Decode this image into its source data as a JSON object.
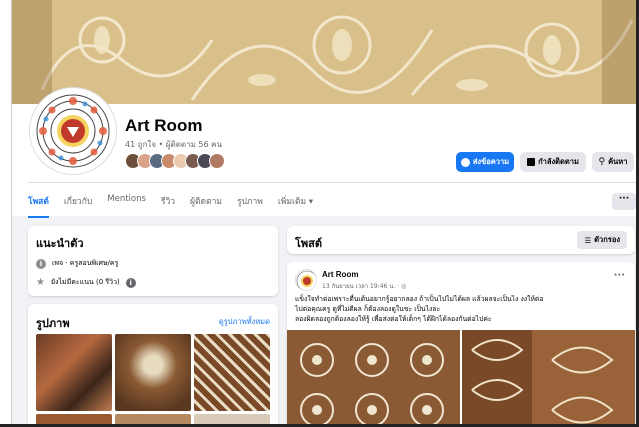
{
  "page": {
    "name": "Art Room",
    "stats": "41 ถูกใจ • ผู้ติดตาม 56 คน"
  },
  "actions": {
    "message": "ส่งข้อความ",
    "following": "กำลังติดตาม",
    "search": "ค้นหา"
  },
  "tabs": [
    {
      "label": "โพสต์"
    },
    {
      "label": "เกี่ยวกับ"
    },
    {
      "label": "Mentions"
    },
    {
      "label": "รีวิว"
    },
    {
      "label": "ผู้ติดตาม"
    },
    {
      "label": "รูปภาพ"
    },
    {
      "label": "เพิ่มเติม ▾"
    }
  ],
  "more_menu": "···",
  "intro": {
    "title": "แนะนำตัว",
    "category": "เพจ · ครูสอนพิเศษ/ครู",
    "reviews": "ยังไม่มีคะแนน (0 รีวิว)"
  },
  "photos": {
    "title": "รูปภาพ",
    "see_all": "ดูรูปภาพทั้งหมด"
  },
  "posts": {
    "title": "โพสต์",
    "filter": "ตัวกรอง"
  },
  "post": {
    "author": "Art Room",
    "time": "13 กันยายน เวลา 19:46 น. · ◎",
    "text_line1": "แข็งใจทำต่อเพราะตื่นเต้นอยากรู้อยากลอง ถ้าเป็นไปไม่ได้ผล แล้วผลจะเป็นไง งงให้ต่อ",
    "text_line2": "ไปต่อคุณครู ดูที่ไม่ดีผล ก็ต้องลองดูในขะ เป็นไงละ",
    "text_line3": "ลองผิดลองถูกต้องลองให้รู้ เพื่อส่งต่อให้เด็กๆ ได้ฝึกได้ลองกันต่อไปค่ะ",
    "menu": "···"
  },
  "colors": {
    "accent": "#1877f2",
    "background": "#f0f2f5",
    "card": "#ffffff"
  }
}
